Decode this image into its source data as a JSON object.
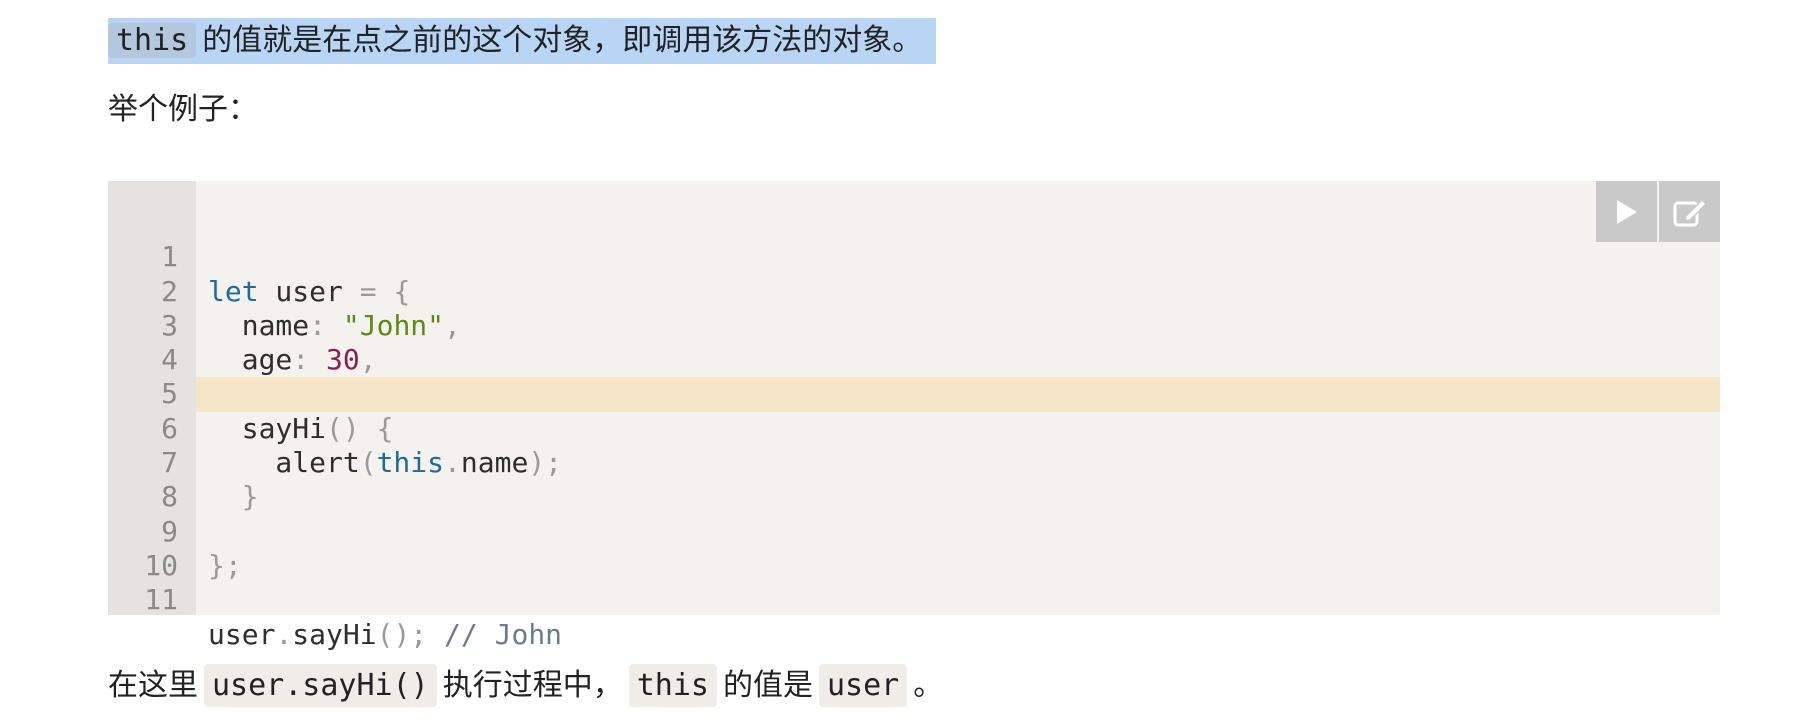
{
  "intro": {
    "code": "this",
    "text": "的值就是在点之前的这个对象，即调用该方法的对象。"
  },
  "example_label": "举个例子：",
  "code_block": {
    "lines": [
      {
        "n": "1"
      },
      {
        "n": "2"
      },
      {
        "n": "3"
      },
      {
        "n": "4"
      },
      {
        "n": "5"
      },
      {
        "n": "6"
      },
      {
        "n": "7"
      },
      {
        "n": "8"
      },
      {
        "n": "9"
      },
      {
        "n": "10"
      },
      {
        "n": "11"
      }
    ],
    "tokens": {
      "l1_kw": "let",
      "l1_rest": " user ",
      "l1_eq": "=",
      "l1_brace": " {",
      "l2_key": "  name",
      "l2_colon": ":",
      "l2_str": " \"John\"",
      "l2_comma": ",",
      "l3_key": "  age",
      "l3_colon": ":",
      "l3_num": " 30",
      "l3_comma": ",",
      "l5_fn": "  sayHi",
      "l5_paren": "()",
      "l5_brace": " {",
      "l6_fn": "    alert",
      "l6_p1": "(",
      "l6_this": "this",
      "l6_dot": ".",
      "l6_prop": "name",
      "l6_p2": ");",
      "l7_brace": "  }",
      "l9_end": "};",
      "l11_obj": "user",
      "l11_dot": ".",
      "l11_fn": "sayHi",
      "l11_call": "();",
      "l11_comment": " // John"
    },
    "highlighted_line": "6"
  },
  "result": {
    "prefix": "在这里",
    "code1": "user.sayHi()",
    "middle": "执行过程中，",
    "code2": "this",
    "middle2": "的值是",
    "code3": "user",
    "suffix": "。"
  },
  "toolbar": {
    "run_icon": "play-icon",
    "edit_icon": "edit-icon"
  }
}
